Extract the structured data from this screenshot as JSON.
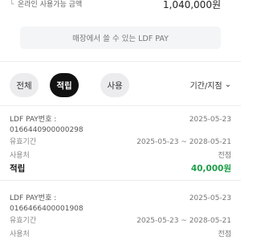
{
  "summary": {
    "arrow": "└",
    "label": "온라인 사용가능 금액",
    "amount": "1,040,000원"
  },
  "pay_notice": "매장에서 쓸 수 있는 LDF PAY",
  "tabs": [
    {
      "label": "전체",
      "active": false
    },
    {
      "label": "적립",
      "active": true
    },
    {
      "label": "사용",
      "active": false
    }
  ],
  "period_filter": {
    "label": "기간/지점",
    "icon": "chevron-down-icon"
  },
  "history": [
    {
      "pay_label": "LDF PAY번호 :",
      "date": "2025-05-23",
      "pay_number": "0166440900000298",
      "validity_label": "유효기간",
      "validity": "2025-05-23 ~ 2028-05-21",
      "usage_label": "사용처",
      "usage": "전점",
      "type": "적립",
      "amount": "40,000원"
    },
    {
      "pay_label": "LDF PAY번호 :",
      "date": "2025-05-23",
      "pay_number": "0166466400001908",
      "validity_label": "유효기간",
      "validity": "2025-05-23 ~ 2028-05-21",
      "usage_label": "사용처",
      "usage": "전점"
    }
  ],
  "colors": {
    "accent_green": "#1e9e49",
    "active_tab": "#111111",
    "inactive_tab": "#ececee"
  }
}
